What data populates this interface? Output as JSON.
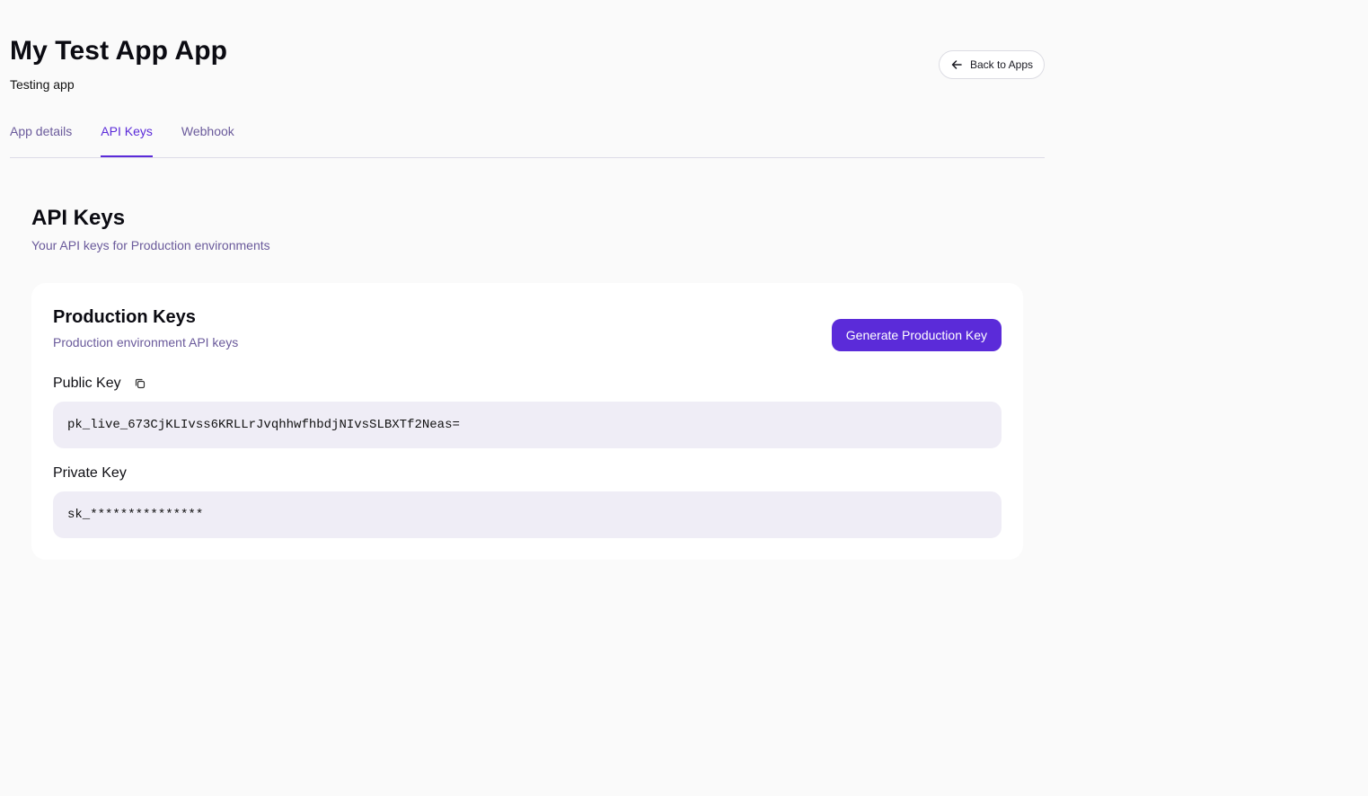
{
  "header": {
    "title": "My Test App App",
    "subtitle": "Testing app",
    "back_label": "Back to Apps"
  },
  "tabs": [
    {
      "label": "App details",
      "active": false
    },
    {
      "label": "API Keys",
      "active": true
    },
    {
      "label": "Webhook",
      "active": false
    }
  ],
  "section": {
    "title": "API Keys",
    "subtitle": "Your API keys for Production environments"
  },
  "card": {
    "title": "Production Keys",
    "subtitle": "Production environment API keys",
    "generate_label": "Generate Production Key",
    "public_key_label": "Public Key",
    "public_key_value": "pk_live_673CjKLIvss6KRLLrJvqhhwfhbdjNIvsSLBXTf2Neas=",
    "private_key_label": "Private Key",
    "private_key_value": "sk_***************"
  },
  "colors": {
    "accent": "#5b2bd9",
    "muted_text": "#6a5a9b",
    "key_background": "#efedf6"
  },
  "icons": {
    "back": "arrow-left-icon",
    "copy": "copy-icon"
  }
}
